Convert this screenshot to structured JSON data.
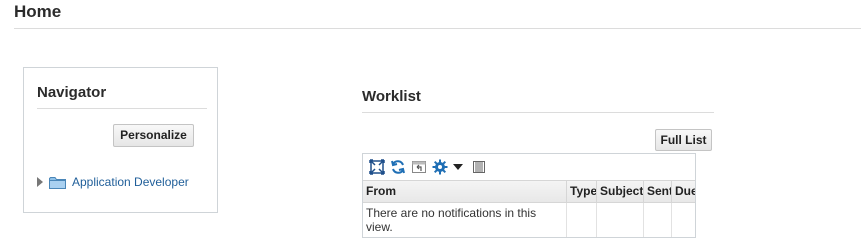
{
  "page": {
    "title": "Home"
  },
  "navigator": {
    "title": "Navigator",
    "personalize_label": "Personalize",
    "tree_items": [
      {
        "label": "Application Developer",
        "icon": "folder-icon"
      }
    ]
  },
  "worklist": {
    "title": "Worklist",
    "full_list_label": "Full List",
    "toolbar_icons": [
      "detach-icon",
      "refresh-icon",
      "freeze-icon",
      "gear-icon",
      "dropdown-arrow-icon",
      "columns-icon"
    ],
    "columns": [
      "From",
      "Type",
      "Subject",
      "Sent",
      "Due"
    ],
    "empty_message": "There are no notifications in this view."
  },
  "colors": {
    "link": "#1f5e99",
    "icon_blue": "#1f6fb5",
    "border": "#cfd4d8"
  }
}
